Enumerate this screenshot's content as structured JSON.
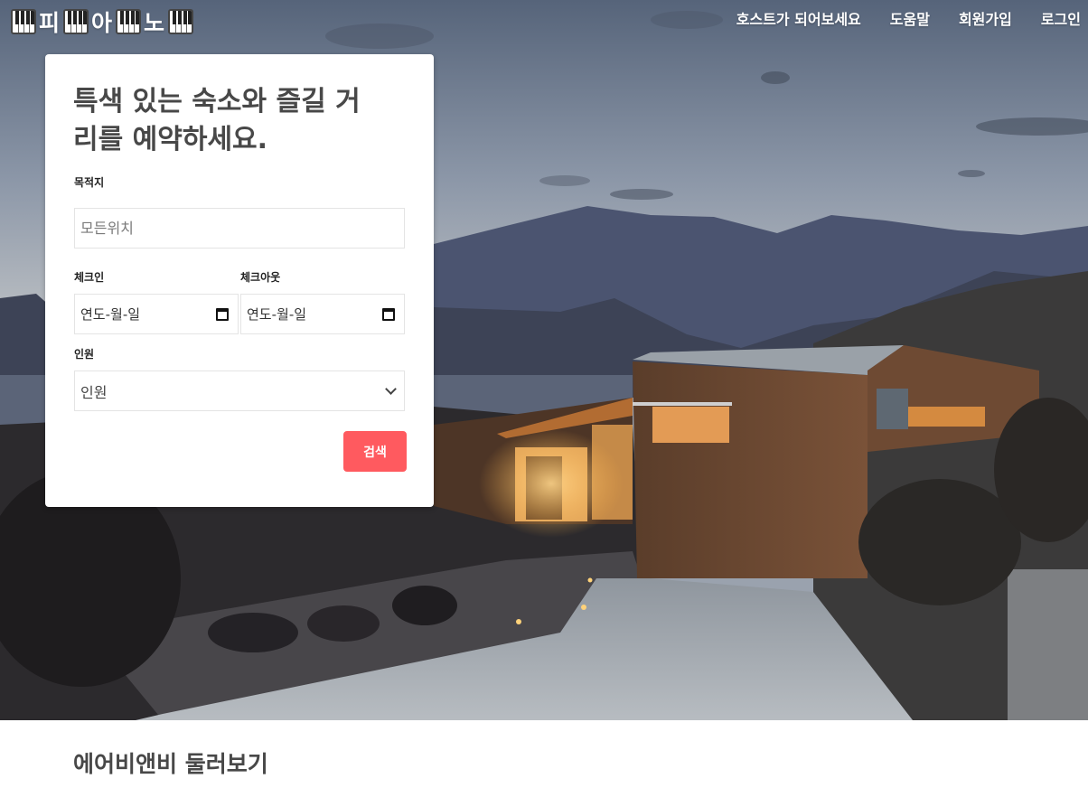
{
  "logo": {
    "words": [
      "피",
      "아",
      "노"
    ]
  },
  "nav": {
    "items": [
      "호스트가 되어보세요",
      "도움말",
      "회원가입",
      "로그인"
    ]
  },
  "search": {
    "heading": "특색 있는 숙소와 즐길 거리를 예약하세요.",
    "destination": {
      "label": "목적지",
      "placeholder": "모든위치"
    },
    "checkin": {
      "label": "체크인",
      "value": "연도-월-일"
    },
    "checkout": {
      "label": "체크아웃",
      "value": "연도-월-일"
    },
    "guests": {
      "label": "인원",
      "selected": "인원"
    },
    "submit_label": "검색"
  },
  "explore": {
    "title": "에어비앤비 둘러보기"
  },
  "colors": {
    "accent": "#ff5a5f",
    "heading": "#484848"
  },
  "icons": [
    "piano-icon",
    "calendar-icon",
    "chevron-down-icon"
  ]
}
